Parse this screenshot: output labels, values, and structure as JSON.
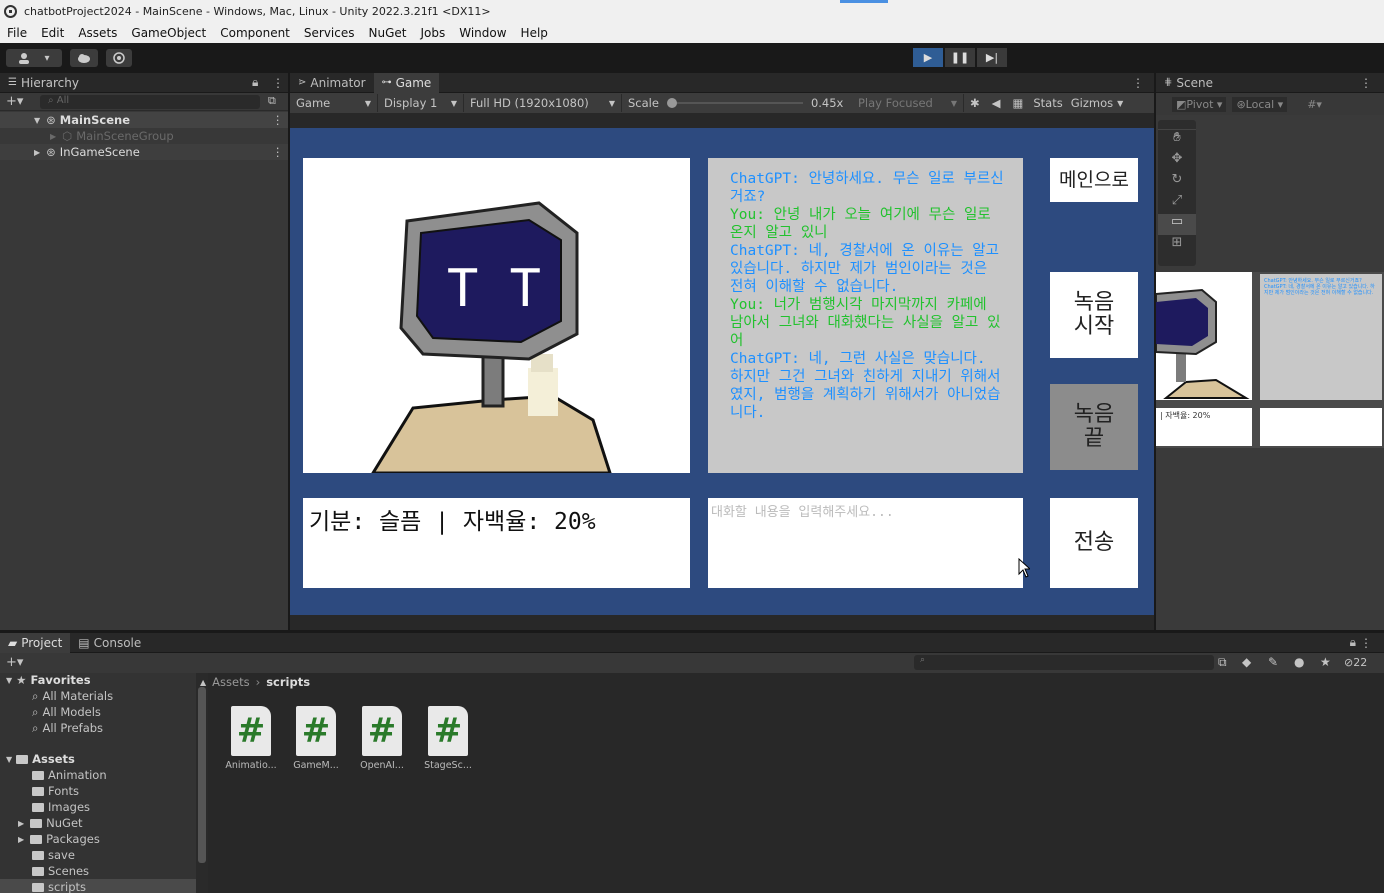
{
  "window": {
    "title": "chatbotProject2024 - MainScene - Windows, Mac, Linux - Unity 2022.3.21f1 <DX11>"
  },
  "menu": [
    "File",
    "Edit",
    "Assets",
    "GameObject",
    "Component",
    "Services",
    "NuGet",
    "Jobs",
    "Window",
    "Help"
  ],
  "hierarchy": {
    "tab": "Hierarchy",
    "search_placeholder": "All",
    "items": [
      {
        "label": "MainScene",
        "level": 0,
        "expanded": true
      },
      {
        "label": "MainSceneGroup",
        "level": 1,
        "disabled": true
      },
      {
        "label": "InGameScene",
        "level": 0,
        "expanded": false
      }
    ]
  },
  "tabs": {
    "animator": "Animator",
    "game": "Game",
    "scene": "Scene"
  },
  "game_toolbar": {
    "view": "Game",
    "display": "Display 1",
    "resolution": "Full HD (1920x1080)",
    "scale_label": "Scale",
    "scale_value": "0.45x",
    "play_focused": "Play Focused",
    "stats": "Stats",
    "gizmos": "Gizmos"
  },
  "scene_toolbar": {
    "pivot": "Pivot",
    "local": "Local"
  },
  "game_ui": {
    "robot_face": "T T",
    "chat_lines": [
      {
        "speaker": "gpt",
        "text": "ChatGPT: 안녕하세요. 무슨 일로 부르신거죠?"
      },
      {
        "speaker": "you",
        "text": "You: 안녕 내가 오늘 여기에 무슨 일로 온지 알고 있니"
      },
      {
        "speaker": "gpt",
        "text": "ChatGPT: 네, 경찰서에 온 이유는 알고 있습니다. 하지만 제가 범인이라는 것은 전혀 이해할 수 없습니다."
      },
      {
        "speaker": "you",
        "text": "You: 너가 범행시각 마지막까지 카페에 남아서 그녀와 대화했다는 사실을 알고 있어"
      },
      {
        "speaker": "gpt",
        "text": "ChatGPT: 네, 그런 사실은 맞습니다. 하지만 그건 그녀와 친하게 지내기 위해서였지, 범행을 계획하기 위해서가 아니었습니다."
      }
    ],
    "btn_main": "메인으로",
    "btn_record_start": "녹음\n시작",
    "btn_record_end": "녹음\n끝",
    "btn_send": "전송",
    "mood_text": "기분: 슬픔 | 자백율: 20%",
    "input_placeholder": "대화할 내용을 입력해주세요..."
  },
  "scene_preview": {
    "mood_text": "| 자백율: 20%"
  },
  "project": {
    "tabs": [
      "Project",
      "Console"
    ],
    "favorites_label": "Favorites",
    "favorites": [
      "All Materials",
      "All Models",
      "All Prefabs"
    ],
    "assets_label": "Assets",
    "folders": [
      "Animation",
      "Fonts",
      "Images",
      "NuGet",
      "Packages",
      "save",
      "Scenes",
      "scripts"
    ],
    "breadcrumb": [
      "Assets",
      "scripts"
    ],
    "files": [
      "Animatio...",
      "GameM...",
      "OpenAI...",
      "StageSc..."
    ],
    "hidden_count": "22"
  },
  "colors": {
    "game_bg": "#2d4a7f",
    "chat_gpt": "#1e90ff",
    "chat_you": "#22c22e"
  }
}
